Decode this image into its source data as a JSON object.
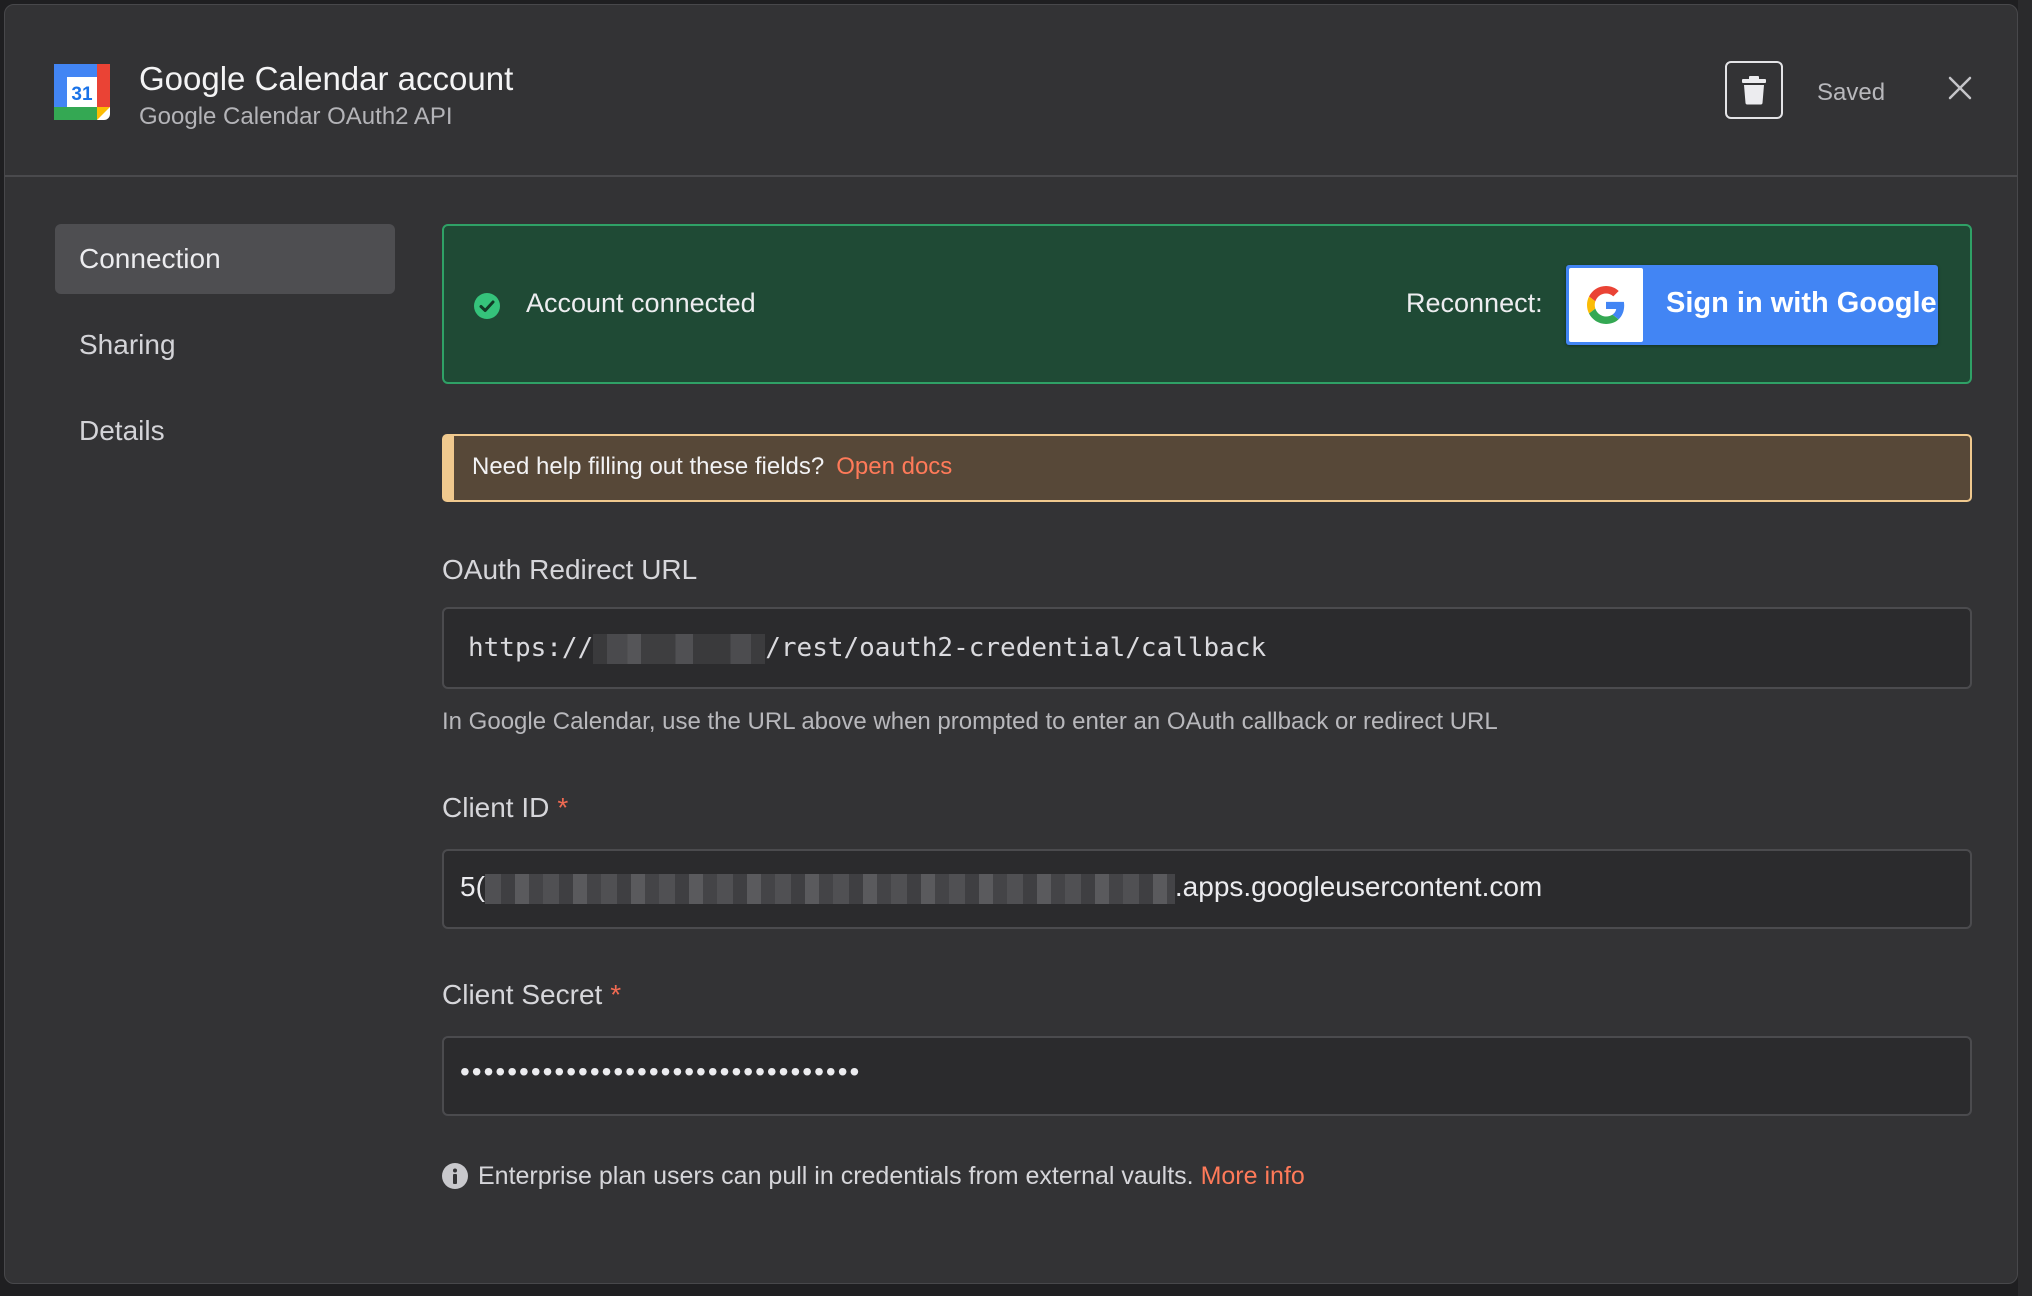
{
  "header": {
    "title": "Google Calendar account",
    "subtitle": "Google Calendar OAuth2 API",
    "calendar_icon_day": "31",
    "saved_label": "Saved",
    "icons": {
      "app": "google-calendar-icon",
      "delete": "trash-icon",
      "close": "close-icon"
    }
  },
  "sidenav": {
    "items": [
      {
        "label": "Connection",
        "active": true
      },
      {
        "label": "Sharing",
        "active": false
      },
      {
        "label": "Details",
        "active": false
      }
    ]
  },
  "connection": {
    "status_text": "Account connected",
    "reconnect_label": "Reconnect:",
    "google_button_label": "Sign in with Google"
  },
  "help": {
    "text": "Need help filling out these fields?",
    "link": "Open docs"
  },
  "fields": {
    "redirect": {
      "label": "OAuth Redirect URL",
      "value_prefix": "https://",
      "value_suffix": "/rest/oauth2-credential/callback",
      "hint": "In Google Calendar, use the URL above when prompted to enter an OAuth callback or redirect URL"
    },
    "client_id": {
      "label": "Client ID",
      "required_mark": "*",
      "value_prefix": "5(",
      "value_suffix": ".apps.googleusercontent.com"
    },
    "client_secret": {
      "label": "Client Secret",
      "required_mark": "*",
      "masked_value": "••••••••••••••••••••••••••••••••••"
    }
  },
  "footer": {
    "info_text": "Enterprise plan users can pull in credentials from external vaults.",
    "info_link": "More info"
  },
  "colors": {
    "success_bg": "#1f4a35",
    "success_border": "#2fa166",
    "warning_bg": "#574838",
    "warning_border": "#f0c98e",
    "link": "#ff7a59",
    "google_blue": "#4285f4"
  }
}
